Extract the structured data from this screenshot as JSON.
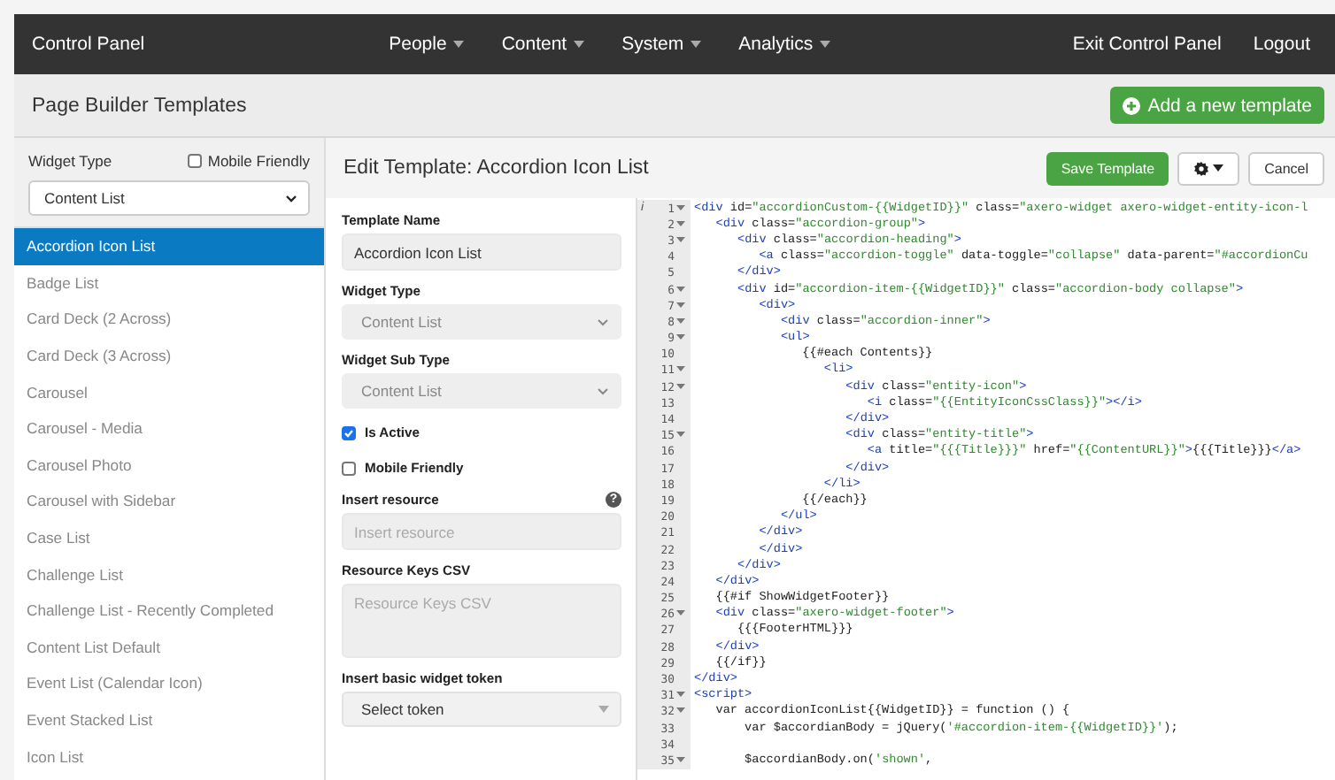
{
  "nav": {
    "brand": "Control Panel",
    "menus": [
      {
        "label": "People"
      },
      {
        "label": "Content"
      },
      {
        "label": "System"
      },
      {
        "label": "Analytics"
      }
    ],
    "right": [
      "Exit Control Panel",
      "Logout"
    ]
  },
  "header": {
    "title": "Page Builder Templates",
    "add_button": "Add a new template"
  },
  "sidebar": {
    "widget_type_label": "Widget Type",
    "mobile_friendly": {
      "label": "Mobile Friendly",
      "checked": false
    },
    "widget_type_value": "Content List",
    "items": [
      {
        "label": "Accordion Icon List",
        "selected": true
      },
      {
        "label": "Badge List",
        "selected": false
      },
      {
        "label": "Card Deck (2 Across)",
        "selected": false
      },
      {
        "label": "Card Deck (3 Across)",
        "selected": false
      },
      {
        "label": "Carousel",
        "selected": false
      },
      {
        "label": "Carousel - Media",
        "selected": false
      },
      {
        "label": "Carousel Photo",
        "selected": false
      },
      {
        "label": "Carousel with Sidebar",
        "selected": false
      },
      {
        "label": "Case List",
        "selected": false
      },
      {
        "label": "Challenge List",
        "selected": false
      },
      {
        "label": "Challenge List - Recently Completed",
        "selected": false
      },
      {
        "label": "Content List Default",
        "selected": false
      },
      {
        "label": "Event List (Calendar Icon)",
        "selected": false
      },
      {
        "label": "Event Stacked List",
        "selected": false
      },
      {
        "label": "Icon List",
        "selected": false
      }
    ]
  },
  "editor": {
    "title": "Edit Template: Accordion Icon List",
    "save_button": "Save Template",
    "cancel_button": "Cancel",
    "form": [
      {
        "kind": "input",
        "label": "Template Name",
        "value": "Accordion Icon List"
      },
      {
        "kind": "select",
        "label": "Widget Type",
        "value": "Content List",
        "disabled": true
      },
      {
        "kind": "select",
        "label": "Widget Sub Type",
        "value": "Content List",
        "disabled": true
      },
      {
        "kind": "checkbox",
        "label": "Is Active",
        "checked": true
      },
      {
        "kind": "checkbox",
        "label": "Mobile Friendly",
        "checked": false
      },
      {
        "kind": "input",
        "label": "Insert resource",
        "placeholder": "Insert resource",
        "help": "?"
      },
      {
        "kind": "textarea",
        "label": "Resource Keys CSV",
        "placeholder": "Resource Keys CSV"
      },
      {
        "kind": "select",
        "label": "Insert basic widget token",
        "value": "Select token",
        "disabled": false
      }
    ],
    "code": [
      {
        "num": "1",
        "fold": true,
        "annotation": "i",
        "text": "<div id=\"accordionCustom-{{WidgetID}}\" class=\"axero-widget axero-widget-entity-icon-l"
      },
      {
        "num": "2",
        "fold": true,
        "text": "   <div class=\"accordion-group\">"
      },
      {
        "num": "3",
        "fold": true,
        "text": "      <div class=\"accordion-heading\">"
      },
      {
        "num": "4",
        "fold": false,
        "text": "         <a class=\"accordion-toggle\" data-toggle=\"collapse\" data-parent=\"#accordionCu"
      },
      {
        "num": "5",
        "fold": false,
        "text": "      </div>"
      },
      {
        "num": "6",
        "fold": true,
        "text": "      <div id=\"accordion-item-{{WidgetID}}\" class=\"accordion-body collapse\">"
      },
      {
        "num": "7",
        "fold": true,
        "text": "         <div>"
      },
      {
        "num": "8",
        "fold": true,
        "text": "            <div class=\"accordion-inner\">"
      },
      {
        "num": "9",
        "fold": true,
        "text": "            <ul>"
      },
      {
        "num": "10",
        "fold": false,
        "text": "               {{#each Contents}}"
      },
      {
        "num": "11",
        "fold": true,
        "text": "                  <li>"
      },
      {
        "num": "12",
        "fold": true,
        "text": "                     <div class=\"entity-icon\">"
      },
      {
        "num": "13",
        "fold": false,
        "text": "                        <i class=\"{{EntityIconCssClass}}\"></i>"
      },
      {
        "num": "14",
        "fold": false,
        "text": "                     </div>"
      },
      {
        "num": "15",
        "fold": true,
        "text": "                     <div class=\"entity-title\">"
      },
      {
        "num": "16",
        "fold": false,
        "text": "                        <a title=\"{{{Title}}}\" href=\"{{ContentURL}}\">{{{Title}}}</a>"
      },
      {
        "num": "17",
        "fold": false,
        "text": "                     </div>"
      },
      {
        "num": "18",
        "fold": false,
        "text": "                  </li>"
      },
      {
        "num": "19",
        "fold": false,
        "text": "               {{/each}}"
      },
      {
        "num": "20",
        "fold": false,
        "text": "            </ul>"
      },
      {
        "num": "21",
        "fold": false,
        "text": "         </div>"
      },
      {
        "num": "22",
        "fold": false,
        "text": "         </div>"
      },
      {
        "num": "23",
        "fold": false,
        "text": "      </div>"
      },
      {
        "num": "24",
        "fold": false,
        "text": "   </div>"
      },
      {
        "num": "25",
        "fold": false,
        "text": "   {{#if ShowWidgetFooter}}"
      },
      {
        "num": "26",
        "fold": true,
        "text": "   <div class=\"axero-widget-footer\">"
      },
      {
        "num": "27",
        "fold": false,
        "text": "      {{{FooterHTML}}}"
      },
      {
        "num": "28",
        "fold": false,
        "text": "   </div>"
      },
      {
        "num": "29",
        "fold": false,
        "text": "   {{/if}}"
      },
      {
        "num": "30",
        "fold": false,
        "text": "</div>"
      },
      {
        "num": "31",
        "fold": true,
        "text": "<script>"
      },
      {
        "num": "32",
        "fold": true,
        "text": "   var accordionIconList{{WidgetID}} = function () {"
      },
      {
        "num": "33",
        "fold": false,
        "text": "       var $accordianBody = jQuery('#accordion-item-{{WidgetID}}');"
      },
      {
        "num": "34",
        "fold": false
      },
      {
        "num": "35",
        "fold": true,
        "text": "       $accordianBody.on('shown',"
      }
    ]
  }
}
